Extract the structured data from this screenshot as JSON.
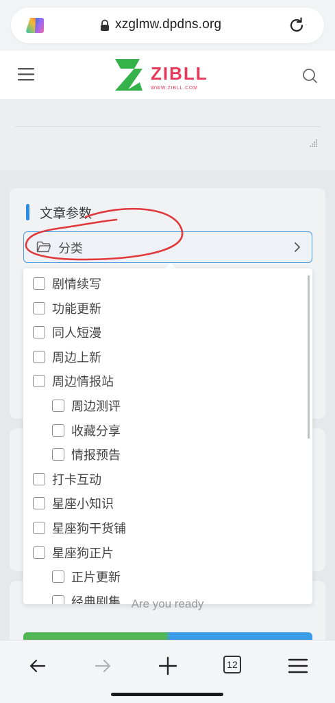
{
  "browser": {
    "url": "xzglmw.dpdns.org",
    "tabs_count": "12"
  },
  "site": {
    "logo_text": "ZIBLL",
    "logo_subtext": "WWW.ZIBLL.COM",
    "colors": {
      "logo_green": "#36b24a",
      "logo_red": "#e8395a",
      "accent": "#2b8be6"
    }
  },
  "article_params": {
    "title": "文章参数",
    "category_label": "分类"
  },
  "category_dropdown": {
    "items": [
      {
        "label": "剧情续写",
        "level": 0
      },
      {
        "label": "功能更新",
        "level": 0
      },
      {
        "label": "同人短漫",
        "level": 0
      },
      {
        "label": "周边上新",
        "level": 0
      },
      {
        "label": "周边情报站",
        "level": 0
      },
      {
        "label": "周边测评",
        "level": 1
      },
      {
        "label": "收藏分享",
        "level": 1
      },
      {
        "label": "情报预告",
        "level": 1
      },
      {
        "label": "打卡互动",
        "level": 0
      },
      {
        "label": "星座小知识",
        "level": 0
      },
      {
        "label": "星座狗干货铺",
        "level": 0
      },
      {
        "label": "星座狗正片",
        "level": 0
      },
      {
        "label": "正片更新",
        "level": 1
      },
      {
        "label": "经典剧集",
        "level": 1
      }
    ]
  },
  "ready_text": "Are you ready",
  "icons": [
    "copilot-icon",
    "lock-icon",
    "reload-icon",
    "menu-icon",
    "search-icon",
    "folder-icon",
    "chevron-right-icon",
    "back-arrow-icon",
    "forward-arrow-icon",
    "plus-icon",
    "tabs-icon",
    "hamburger-icon"
  ]
}
